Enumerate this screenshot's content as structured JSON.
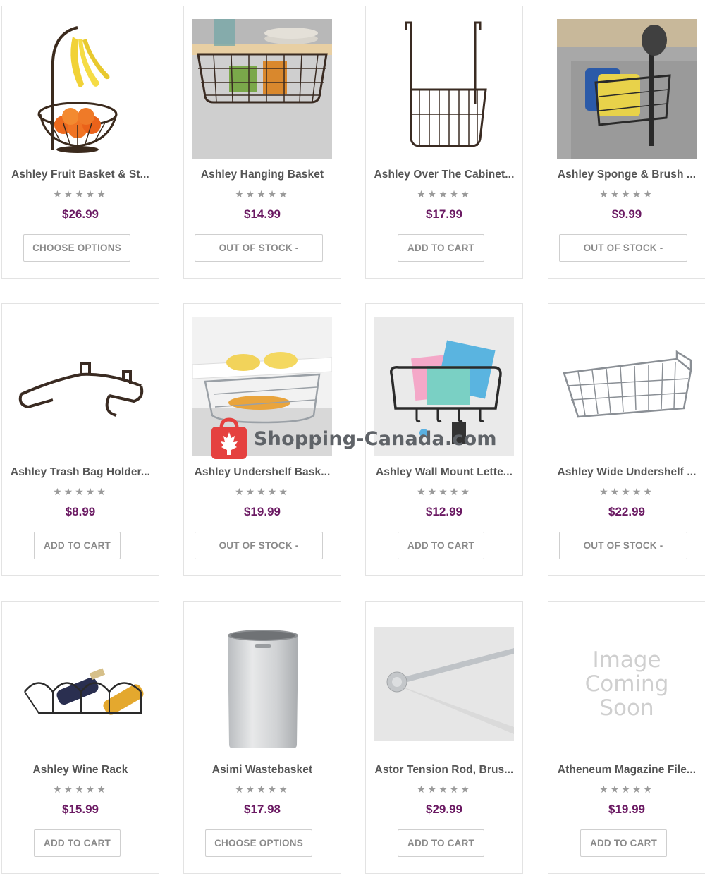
{
  "products": [
    {
      "title": "Ashley Fruit Basket & St...",
      "price": "$26.99",
      "button": "CHOOSE OPTIONS",
      "rating": "★★★★★",
      "image": "fruit-basket"
    },
    {
      "title": "Ashley Hanging Basket",
      "price": "$14.99",
      "button": "OUT OF STOCK -",
      "rating": "★★★★★",
      "image": "hanging-basket"
    },
    {
      "title": "Ashley Over The Cabinet...",
      "price": "$17.99",
      "button": "ADD TO CART",
      "rating": "★★★★★",
      "image": "over-cabinet-basket"
    },
    {
      "title": "Ashley Sponge & Brush ...",
      "price": "$9.99",
      "button": "OUT OF STOCK -",
      "rating": "★★★★★",
      "image": "sponge-brush-holder"
    },
    {
      "title": "Ashley Trash Bag Holder...",
      "price": "$8.99",
      "button": "ADD TO CART",
      "rating": "★★★★★",
      "image": "trash-bag-holder"
    },
    {
      "title": "Ashley Undershelf Bask...",
      "price": "$19.99",
      "button": "OUT OF STOCK -",
      "rating": "★★★★★",
      "image": "undershelf-basket"
    },
    {
      "title": "Ashley Wall Mount Lette...",
      "price": "$12.99",
      "button": "ADD TO CART",
      "rating": "★★★★★",
      "image": "wall-mount-letter-rack"
    },
    {
      "title": "Ashley Wide Undershelf ...",
      "price": "$22.99",
      "button": "OUT OF STOCK -",
      "rating": "★★★★★",
      "image": "wide-undershelf-basket"
    },
    {
      "title": "Ashley Wine Rack",
      "price": "$15.99",
      "button": "ADD TO CART",
      "rating": "★★★★★",
      "image": "wine-rack"
    },
    {
      "title": "Asimi Wastebasket",
      "price": "$17.98",
      "button": "CHOOSE OPTIONS",
      "rating": "★★★★★",
      "image": "wastebasket"
    },
    {
      "title": "Astor Tension Rod, Brus...",
      "price": "$29.99",
      "button": "ADD TO CART",
      "rating": "★★★★★",
      "image": "tension-rod"
    },
    {
      "title": "Atheneum Magazine File...",
      "price": "$19.99",
      "button": "ADD TO CART",
      "rating": "★★★★★",
      "image": "image-coming-soon"
    }
  ],
  "placeholder_image": {
    "line1": "Image",
    "line2": "Coming",
    "line3": "Soon"
  },
  "watermark": {
    "text": "Shopping-Canada.com"
  },
  "colors": {
    "price": "#6b1a63",
    "watermark_red": "#e5413f",
    "border": "#e3e3e3"
  }
}
